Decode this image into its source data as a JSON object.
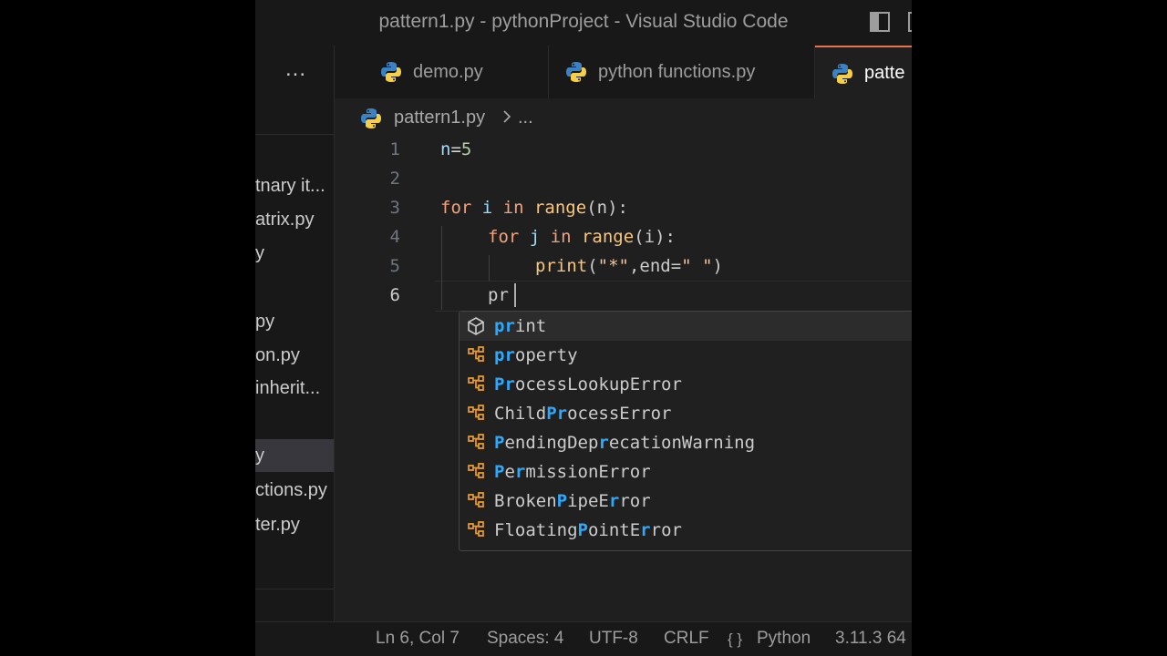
{
  "window": {
    "title": "pattern1.py - pythonProject - Visual Studio Code"
  },
  "sidebar": {
    "more": "...",
    "files": [
      "tnary it...",
      "atrix.py",
      "y",
      "py",
      "on.py",
      "inherit...",
      "y",
      "ctions.py",
      "ter.py"
    ]
  },
  "tabs": [
    {
      "label": "demo.py",
      "icon": "python-icon"
    },
    {
      "label": "python functions.py",
      "icon": "python-icon"
    },
    {
      "label": "patte",
      "icon": "python-icon",
      "active": true
    }
  ],
  "breadcrumb": {
    "file": "pattern1.py",
    "more": "..."
  },
  "editor": {
    "line_numbers": [
      "1",
      "2",
      "3",
      "4",
      "5",
      "6"
    ],
    "lines": {
      "l1": {
        "var": "n",
        "op": "=",
        "num": "5"
      },
      "l3": {
        "kw1": "for",
        "var": " i ",
        "kw2": "in",
        "fn": " range",
        "rest": "(n):"
      },
      "l4": {
        "kw1": "for",
        "var": " j ",
        "kw2": "in",
        "fn": " range",
        "rest": "(i):"
      },
      "l5": {
        "fn": "print",
        "p1": "(",
        "str1": "\"*\"",
        "p2": ",end=",
        "str2": "\" \"",
        "p3": ")"
      },
      "l6": {
        "typed": "pr"
      }
    }
  },
  "suggestions": [
    {
      "parts": [
        [
          "pr",
          true
        ],
        [
          "int",
          false
        ]
      ],
      "icon": "cube-icon"
    },
    {
      "parts": [
        [
          "pr",
          true
        ],
        [
          "operty",
          false
        ]
      ],
      "icon": "class-icon"
    },
    {
      "parts": [
        [
          "Pr",
          true
        ],
        [
          "ocessLookupError",
          false
        ]
      ],
      "icon": "class-icon"
    },
    {
      "parts": [
        [
          "Child",
          false
        ],
        [
          "Pr",
          true
        ],
        [
          "ocessError",
          false
        ]
      ],
      "icon": "class-icon"
    },
    {
      "parts": [
        [
          "P",
          true
        ],
        [
          "endingDep",
          false
        ],
        [
          "r",
          true
        ],
        [
          "ecationWarning",
          false
        ]
      ],
      "icon": "class-icon"
    },
    {
      "parts": [
        [
          "P",
          true
        ],
        [
          "e",
          false
        ],
        [
          "r",
          true
        ],
        [
          "missionError",
          false
        ]
      ],
      "icon": "class-icon"
    },
    {
      "parts": [
        [
          "Broken",
          false
        ],
        [
          "P",
          true
        ],
        [
          "ipeE",
          false
        ],
        [
          "r",
          true
        ],
        [
          "ror",
          false
        ]
      ],
      "icon": "class-icon"
    },
    {
      "parts": [
        [
          "Floating",
          false
        ],
        [
          "P",
          true
        ],
        [
          "ointE",
          false
        ],
        [
          "r",
          true
        ],
        [
          "ror",
          false
        ]
      ],
      "icon": "class-icon"
    }
  ],
  "status": {
    "position": "Ln 6, Col 7",
    "spaces": "Spaces: 4",
    "encoding": "UTF-8",
    "eol": "CRLF",
    "braces": "{ }",
    "language": "Python",
    "interpreter": "3.11.3 64"
  },
  "colors": {
    "accent": "#e8734e",
    "match": "#2aaaff",
    "keyword": "#f2a27d"
  }
}
